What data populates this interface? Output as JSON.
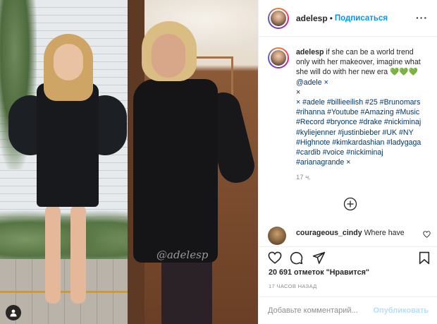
{
  "post": {
    "photo_watermark": "@adelesp"
  },
  "header": {
    "username": "adelesp",
    "separator": "•",
    "follow_label": "Подписаться",
    "more_label": "···"
  },
  "caption": {
    "username": "adelesp",
    "lines": [
      "if she can be a world trend",
      "only with her makeover, imagine what",
      "she will do with her new era 💚💚💚",
      "@adele ×",
      "×",
      "× #adele #billieeilish #25 #Brunomars",
      "#rihanna #Youtube #Amazing #Music",
      "#Record #bryonce #drake #nickiminaj",
      "#kyliejenner #justinbieber #UK #NY",
      "#Highnote #kimkardashian #ladygaga",
      "#cardib #voice #nickiminaj",
      "#arianagrande ×"
    ],
    "time": "17 ч."
  },
  "comment": {
    "username": "courageous_cindy",
    "text": "Where have"
  },
  "likes": {
    "count_text": "20 691 отметок \"Нравится\""
  },
  "posted": {
    "label": "17 ЧАСОВ НАЗАД"
  },
  "add_comment": {
    "placeholder": "Добавьте комментарий...",
    "publish_label": "Опубликовать"
  },
  "colors": {
    "accent_blue": "#0095f6",
    "publish_disabled": "#b2dffc",
    "text_primary": "#262626",
    "text_secondary": "#8e8e8e"
  },
  "icons": [
    "heart-icon",
    "comment-icon",
    "share-icon",
    "bookmark-icon",
    "load-more-icon",
    "tag-user-icon",
    "more-options-icon"
  ]
}
